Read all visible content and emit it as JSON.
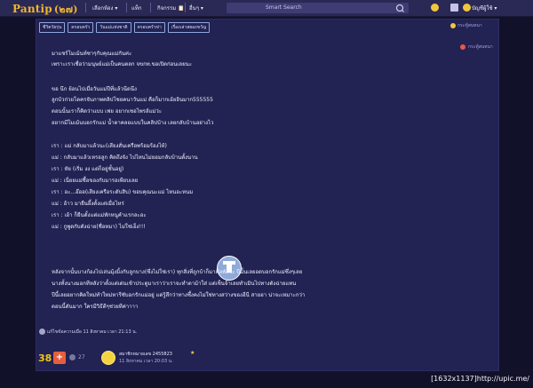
{
  "app": {
    "logo_text": "Pantip",
    "logo_mark": "(๒๗)",
    "nav": [
      {
        "label": "เลือกห้อง ▾"
      },
      {
        "label": "แท็ก"
      },
      {
        "label": "กิจกรรม 📋"
      },
      {
        "label": "อื่นๆ ▾"
      }
    ],
    "search_placeholder": "Smart Search",
    "username": "บัญชีผู้ใช้ ▾"
  },
  "tags": [
    "ชีวิตวัยรุ่น",
    "ครอบครัว",
    "วันแม่แห่งชาติ",
    "ครอบครัวข่า",
    "เรื่องเล่าสยองขวัญ"
  ],
  "reply_link": "กระทู้สนทนา",
  "post": {
    "lines": [
      "มาแชร์โมเม้นท์ซาๆกับคุณแม่กันค่ะ",
      "เพราะเราเชื่อว่ามนุษย์แม่เป็นคนตลก จขกท.ขอเปิดก่อนเลยนะ",
      "",
      "ขอ นึก ย้อนไปเมื่อวันแม่ปีที่แล้วนีดนึง",
      "ลูกบ้วก่วยโดครจับภาพคลิปโชยคนาวันแม่ คือก็มากเอ้ยอินมาก555555",
      "ตอนนั้นเราก็คิดว่าแบบ เฟย อยากเซอไพรส์แม่ว่ะ",
      "อยากมีโมเม้นบอกรักแม่ น้ำตาคลอแบบในคลิปบ้าง เลยกลับบ้านอย่างไว",
      "",
      "เรา : แม่ กลับมาแล้วนะ(เสียงสั่นเครือพร้อมร้องไห้)",
      "แม่ : กลับมาแล้วเหรอลูก คิดถึงจัง ไปไหนไม่ยอมกลับบ้านตั้งนาน",
      "เรา : หัย (เริ่ม งง แต่ก็อยู่ชั้นอยู่)",
      "แม่ : เนี่ยยแม่ซื้อของกับมารอเพียบเลย",
      "เรา : อะ...อ๊ออ(เสียงเครือระดับสิบ) ขอบคุณนะแม่ ไหนอะหนม",
      "แม่ : อ้าว มายืนยึ้งตั้งแต่เมื่อไหร่",
      "เรา : เอ้า ก็ยืนตั้งแต่แม่ทักหนูคำแรกละอะ",
      "แม่ : กูพูดกับตังฉ่าย(ชื่อหมา) ไม่ใช่เอ็ง!!!"
    ],
    "lines2": [
      "หลังจากนั้นบางก้องไปเล่นมุ้งมิ้งกับลูกบาง(ซึ่งไม่ใช่เรา)          ทุกสิ่งที่ถูกบ้าก็มาคือพังซะ ปีนั้นเลยอดบอกรักแม่ซึ่งๆเลย",
      "นางทั้งนางมอกทีหลังว่าตั้งแต่เด่นเช้าประตูมาเราว่าเราจะทำตาม้าใส่ แต่เซ็นจ้าเลยทำเมินไปทางตังฉ่ายแทน",
      "ปีนี้เลยอยากคิดใหม่ทำใหม่หารีซับอกรักแม่อยู่ แต่รู้สึกว่าทางซึ้งคงไม่ใช่ทางสว่างของอีนี สายฮา น่าจะเหมาะกว่า",
      "ตอนนี้ตันมาก ใครมีวิธีดีๆช่วยทีค่าาาา"
    ],
    "edited_text": "แก้ไขข้อความเมื่อ 11 สิงหาคม เวลา 21:13 น."
  },
  "footer": {
    "votes": "38",
    "plus": "+",
    "emotions": "27",
    "author": "สมาชิกหมายเลข 2455823",
    "date": "11 สิงหาคม เวลา 20:03 น."
  },
  "watermark": "[1632x1137]http://upic.me/"
}
